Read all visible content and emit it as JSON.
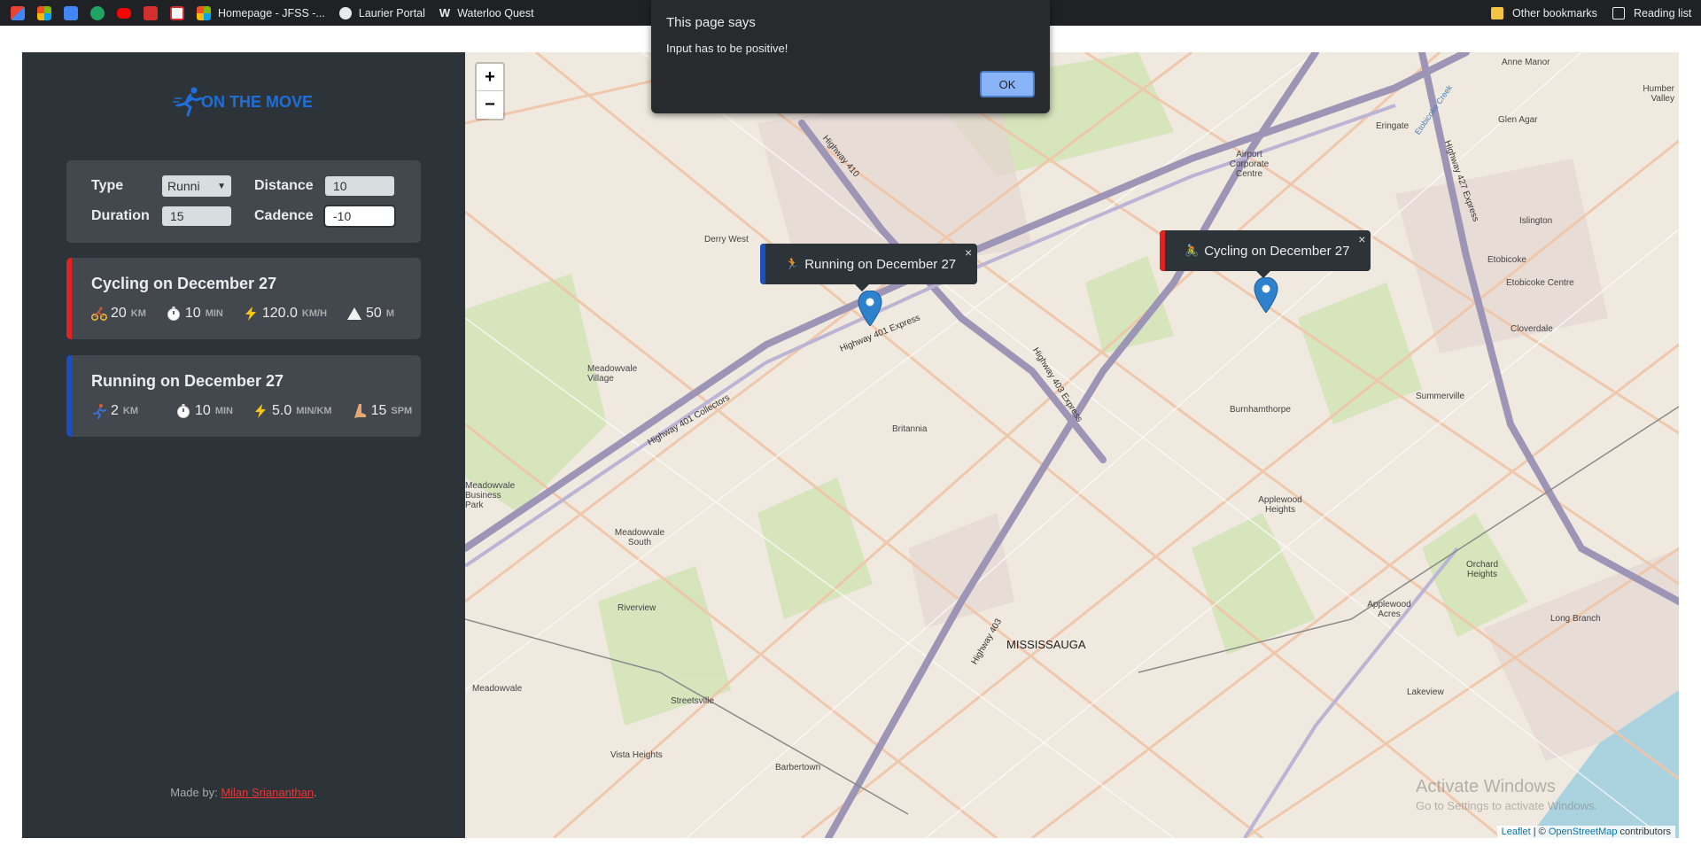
{
  "bookmarks": {
    "items": [
      {
        "icon": "gmail-icon",
        "label": ""
      },
      {
        "icon": "microsoft-icon",
        "label": ""
      },
      {
        "icon": "docs-icon",
        "label": ""
      },
      {
        "icon": "shield-check-icon",
        "label": ""
      },
      {
        "icon": "youtube-icon",
        "label": ""
      },
      {
        "icon": "mcgraw-icon",
        "label": ""
      },
      {
        "icon": "calendar-icon",
        "label": ""
      },
      {
        "icon": "microsoft-icon",
        "label": "Homepage - JFSS -..."
      },
      {
        "icon": "globe-icon",
        "label": "Laurier Portal"
      },
      {
        "icon": "w-icon",
        "label": "Waterloo Quest"
      }
    ],
    "other": "Other bookmarks",
    "reading": "Reading list"
  },
  "app": {
    "logo_text": "ON THE MOVE"
  },
  "form": {
    "type_label": "Type",
    "type_value": "Runni",
    "distance_label": "Distance",
    "distance_value": "10",
    "duration_label": "Duration",
    "duration_value": "15",
    "cadence_label": "Cadence",
    "cadence_value": "-10"
  },
  "workouts": [
    {
      "title": "Cycling on December 27",
      "type": "cycling",
      "color": "#e02424",
      "details": [
        {
          "icon": "bike-icon",
          "value": "20",
          "unit": "KM"
        },
        {
          "icon": "stopwatch-icon",
          "value": "10",
          "unit": "MIN"
        },
        {
          "icon": "lightning-icon",
          "value": "120.0",
          "unit": "KM/H"
        },
        {
          "icon": "mountain-icon",
          "value": "50",
          "unit": "M"
        }
      ]
    },
    {
      "title": "Running on December 27",
      "type": "running",
      "color": "#1e4fbf",
      "details": [
        {
          "icon": "runner-icon",
          "value": "2",
          "unit": "KM"
        },
        {
          "icon": "stopwatch-icon",
          "value": "10",
          "unit": "MIN"
        },
        {
          "icon": "lightning-icon",
          "value": "5.0",
          "unit": "MIN/KM"
        },
        {
          "icon": "foot-icon",
          "value": "15",
          "unit": "SPM"
        }
      ]
    }
  ],
  "credit": {
    "prefix": "Made by: ",
    "author": "Milan Sriananthan",
    "suffix": "."
  },
  "map": {
    "zoom_in": "+",
    "zoom_out": "−",
    "popups": [
      {
        "label": "Running on December 27",
        "color": "#1e4fbf",
        "close": "×"
      },
      {
        "label": "Cycling on December 27",
        "color": "#e02424",
        "close": "×"
      }
    ],
    "place_labels": [
      "MISSISSAUGA",
      "Britannia",
      "Burnhamthorpe",
      "Applewood Heights",
      "Meadowvale Village",
      "Meadowvale South",
      "Meadowvale Business Park",
      "Streetsville",
      "Riverview",
      "Meadowvale",
      "Vista Heights",
      "Barbertown",
      "Lakeview",
      "Orchard Heights",
      "Applewood Acres",
      "Long Branch",
      "Islington",
      "Etobicoke",
      "Etobicoke Centre",
      "Cloverdale",
      "Summerville",
      "Eringate",
      "Glen Agar",
      "Anne Manor",
      "Humber Valley",
      "Airport Corporate Centre",
      "Derry West",
      "Highway 401 Express",
      "Highway 401 Collectors",
      "Highway 403",
      "Highway 403 Express",
      "Highway 410",
      "Highway 427 Express",
      "Etobicoke Creek"
    ],
    "attribution_leaflet": "Leaflet",
    "attribution_sep": " | © ",
    "attribution_osm": "OpenStreetMap",
    "attribution_suffix": " contributors",
    "watermark_title": "Activate Windows",
    "watermark_sub": "Go to Settings to activate Windows."
  },
  "alert": {
    "title": "This page says",
    "message": "Input has to be positive!",
    "ok": "OK"
  }
}
